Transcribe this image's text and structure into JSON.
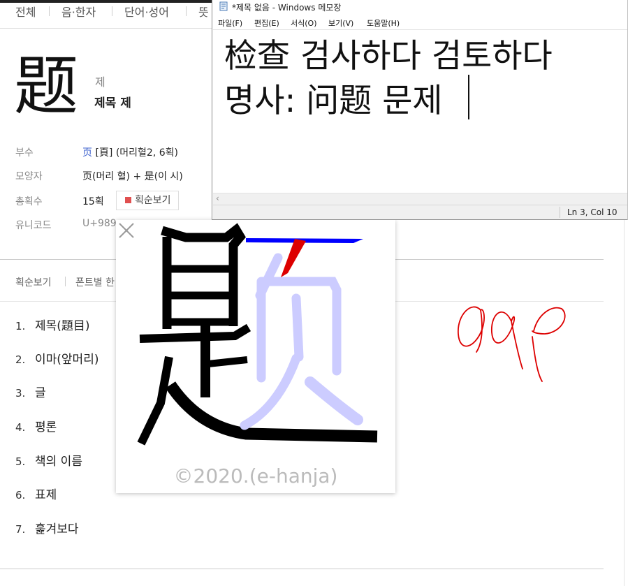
{
  "dictionary": {
    "tabs": [
      "전체",
      "음·한자",
      "단어·성어",
      "뜻"
    ],
    "character": "题",
    "reading_sound": "제",
    "reading_meaning": "제목 제",
    "info": {
      "radical_label": "부수",
      "radical_char": "页",
      "radical_rest": "[頁] (머리혈2, 6획)",
      "shape_label": "모양자",
      "shape_value": "页(머리 혈) + 是(이 시)",
      "strokes_label": "총획수",
      "strokes_value": "15획",
      "stroke_order_button": "획순보기",
      "unicode_label": "유니코드",
      "unicode_value": "U+989"
    },
    "sub_tabs": [
      "획순보기",
      "폰트별 한"
    ],
    "meanings": [
      {
        "num": "1.",
        "text": "제목(題目)"
      },
      {
        "num": "2.",
        "text": "이마(앞머리)"
      },
      {
        "num": "3.",
        "text": "글"
      },
      {
        "num": "4.",
        "text": "평론"
      },
      {
        "num": "5.",
        "text": "책의 이름"
      },
      {
        "num": "6.",
        "text": "표제"
      },
      {
        "num": "7.",
        "text": "훑겨보다"
      }
    ]
  },
  "stroke_popup": {
    "watermark": "©2020.(e-hanja)",
    "colors": {
      "done": "#000000",
      "current_underline": "#0000ff",
      "current_stroke": "#dd0000",
      "pending": "#ccccff"
    }
  },
  "notepad": {
    "title": "*제목 없음 - Windows 메모장",
    "menu": [
      "파일(F)",
      "편집(E)",
      "서식(O)",
      "보기(V)",
      "도움말(H)"
    ],
    "lines": [
      "检查 검사하다 검토하다",
      "명사: 问题 문제"
    ],
    "status": "Ln 3, Col 10"
  },
  "handwriting": {
    "color": "#dd0000"
  }
}
